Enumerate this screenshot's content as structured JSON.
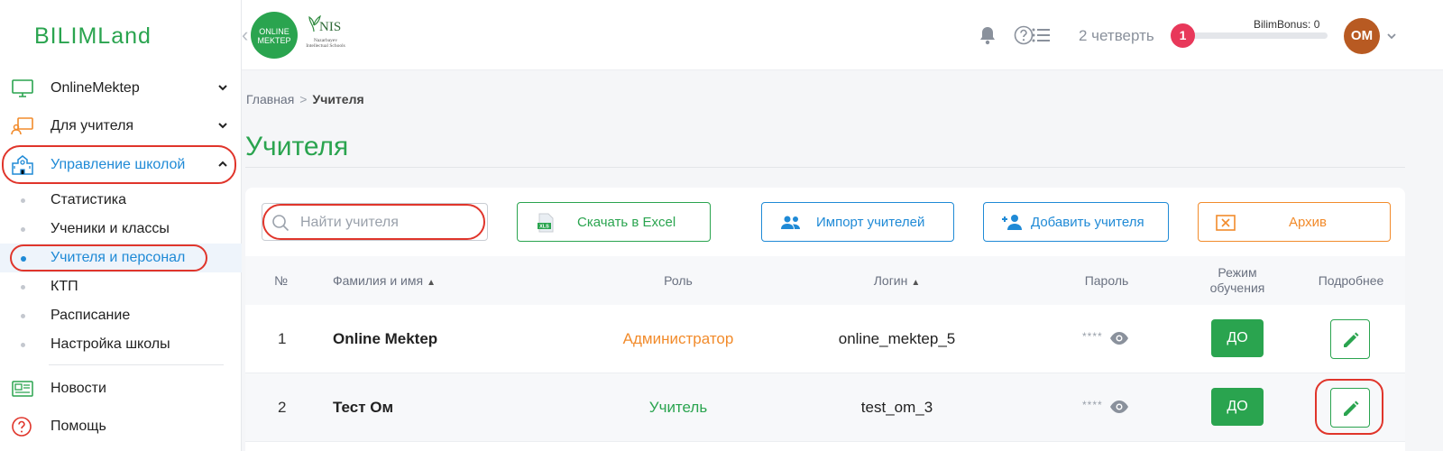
{
  "sidebar": {
    "logo": "BILIMLand",
    "items": [
      {
        "label": "OnlineMektep"
      },
      {
        "label": "Для учителя"
      },
      {
        "label": "Управление школой"
      }
    ],
    "subitems": [
      {
        "label": "Статистика"
      },
      {
        "label": "Ученики и классы"
      },
      {
        "label": "Учителя и персонал"
      },
      {
        "label": "КТП"
      },
      {
        "label": "Расписание"
      },
      {
        "label": "Настройка школы"
      }
    ],
    "bottom_items": [
      {
        "label": "Новости"
      },
      {
        "label": "Помощь"
      }
    ]
  },
  "header": {
    "online_mektep_logo": "ONLINE MEKTEP",
    "nis_logo": "NIS",
    "nis_logo_sub": "Nazarbayev Intellectual Schools",
    "quarter": "2 четверть",
    "notifications_count": "1",
    "bonus_label": "BilimBonus: 0",
    "avatar_initials": "ОМ"
  },
  "breadcrumb": {
    "home": "Главная",
    "separator": ">",
    "current": "Учителя"
  },
  "page": {
    "title": "Учителя"
  },
  "toolbar": {
    "search_placeholder": "Найти учителя",
    "search_value": "",
    "excel_label": "Скачать в Excel",
    "excel_icon_text": "XLS",
    "import_label": "Импорт учителей",
    "add_label": "Добавить учителя",
    "archive_label": "Архив"
  },
  "table": {
    "headers": {
      "num": "№",
      "name": "Фамилия и имя",
      "role": "Роль",
      "login": "Логин",
      "password": "Пароль",
      "mode_line1": "Режим",
      "mode_line2": "обучения",
      "details": "Подробнее"
    },
    "rows": [
      {
        "num": "1",
        "name": "Online Mektep",
        "role": "Администратор",
        "login": "online_mektep_5",
        "password": "****",
        "mode": "ДО"
      },
      {
        "num": "2",
        "name": "Тест Ом",
        "role": "Учитель",
        "login": "test_om_3",
        "password": "****",
        "mode": "ДО"
      }
    ]
  },
  "colors": {
    "brand_green": "#2aa44f",
    "accent_blue": "#1f8ad6",
    "accent_orange": "#f28b2b",
    "highlight_red": "#e0352b",
    "badge_pink": "#e8385a"
  }
}
